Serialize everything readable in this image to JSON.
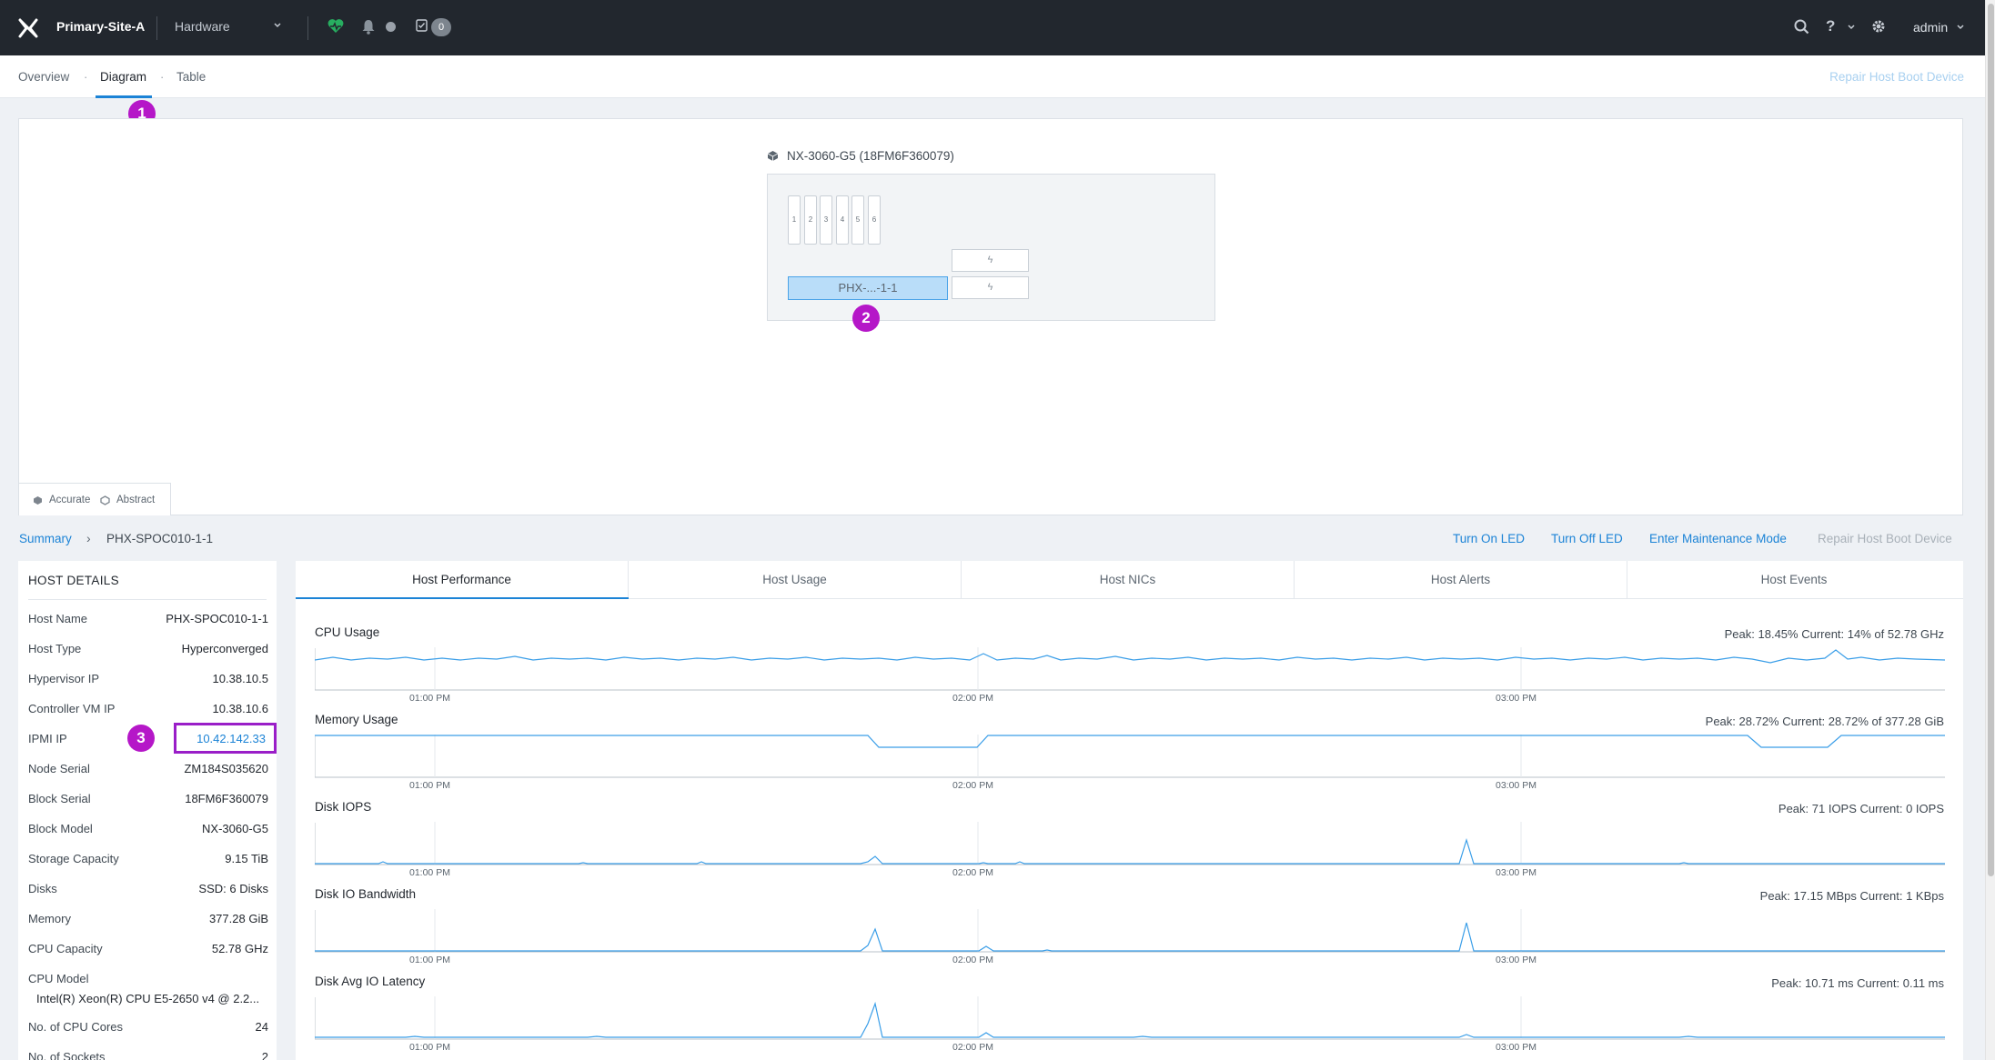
{
  "topbar": {
    "cluster_name": "Primary-Site-A",
    "section_select": "Hardware",
    "task_count": "0",
    "user": "admin",
    "help_label": "?"
  },
  "subnav": {
    "tabs": [
      "Overview",
      "Diagram",
      "Table"
    ],
    "active_tab": "Diagram",
    "repair_label": "Repair Host Boot Device"
  },
  "callouts": [
    "1",
    "2",
    "3"
  ],
  "diagram": {
    "chassis_title": "NX-3060-G5 (18FM6F360079)",
    "slots": [
      "1",
      "2",
      "3",
      "4",
      "5",
      "6"
    ],
    "node_label": "PHX-...-1-1",
    "empty_node_glyph": "ϟ",
    "view_accurate": "Accurate",
    "view_abstract": "Abstract"
  },
  "breadcrumb": {
    "root": "Summary",
    "current": "PHX-SPOC010-1-1"
  },
  "actions": {
    "turn_on_led": "Turn On LED",
    "turn_off_led": "Turn Off LED",
    "maintenance": "Enter Maintenance Mode",
    "repair": "Repair Host Boot Device"
  },
  "host_details": {
    "title": "HOST DETAILS",
    "rows": [
      {
        "key": "Host Name",
        "value": "PHX-SPOC010-1-1"
      },
      {
        "key": "Host Type",
        "value": "Hyperconverged"
      },
      {
        "key": "Hypervisor IP",
        "value": "10.38.10.5"
      },
      {
        "key": "Controller VM IP",
        "value": "10.38.10.6"
      },
      {
        "key": "IPMI IP",
        "value": "10.42.142.33"
      },
      {
        "key": "Node Serial",
        "value": "ZM184S035620"
      },
      {
        "key": "Block Serial",
        "value": "18FM6F360079"
      },
      {
        "key": "Block Model",
        "value": "NX-3060-G5"
      },
      {
        "key": "Storage Capacity",
        "value": "9.15 TiB"
      },
      {
        "key": "Disks",
        "value": "SSD: 6 Disks"
      },
      {
        "key": "Memory",
        "value": "377.28 GiB"
      },
      {
        "key": "CPU Capacity",
        "value": "52.78 GHz"
      },
      {
        "key": "CPU Model",
        "value": ""
      },
      {
        "key": "No. of CPU Cores",
        "value": "24"
      },
      {
        "key": "No. of Sockets",
        "value": "2"
      }
    ],
    "cpu_model_value": "Intel(R) Xeon(R) CPU E5-2650 v4 @ 2.2..."
  },
  "perf_tabs": [
    "Host Performance",
    "Host Usage",
    "Host NICs",
    "Host Alerts",
    "Host Events"
  ],
  "charts": [
    {
      "title": "CPU Usage",
      "stat": "Peak: 18.45%  Current: 14% of 52.78 GHz"
    },
    {
      "title": "Memory Usage",
      "stat": "Peak: 28.72%  Current: 28.72% of 377.28 GiB"
    },
    {
      "title": "Disk IOPS",
      "stat": "Peak: 71 IOPS  Current: 0 IOPS"
    },
    {
      "title": "Disk IO Bandwidth",
      "stat": "Peak: 17.15 MBps  Current: 1 KBps"
    },
    {
      "title": "Disk Avg IO Latency",
      "stat": "Peak: 10.71 ms  Current: 0.11 ms"
    }
  ],
  "time_ticks": [
    "01:00 PM",
    "02:00 PM",
    "03:00 PM"
  ],
  "colors": {
    "topbar": "#22272e",
    "accent": "#1b83d6",
    "callout": "#b517c8",
    "health": "#27ae60",
    "chart_line": "#3a9ee8"
  }
}
